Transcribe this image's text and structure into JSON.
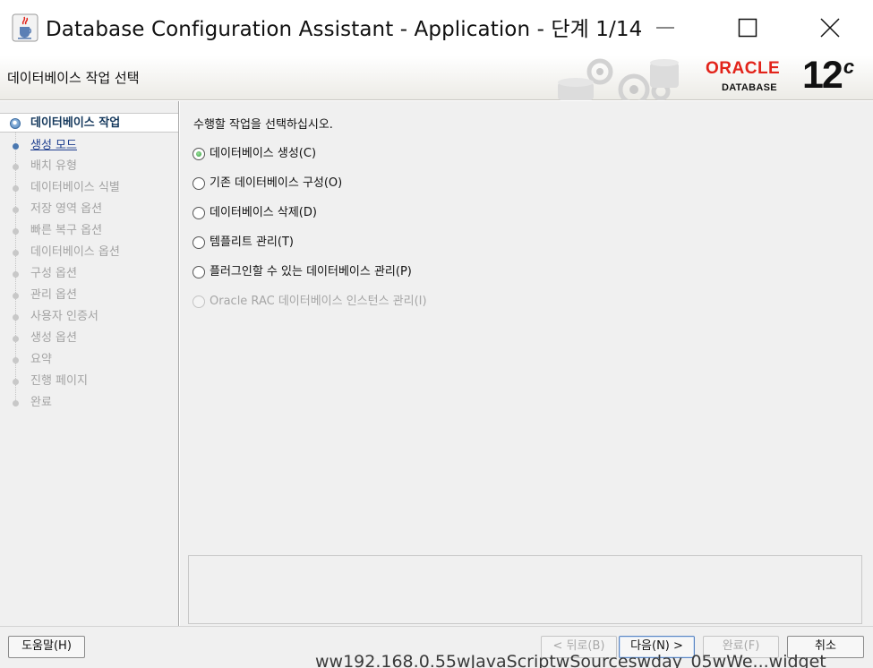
{
  "window": {
    "title": "Database Configuration Assistant - Application - 단계 1/14",
    "icon": "java-cup-icon"
  },
  "header": {
    "title": "데이터베이스 작업 선택",
    "oracle_word": "ORACLE",
    "oracle_product": "DATABASE",
    "oracle_version": "12",
    "oracle_version_suffix": "c",
    "brand_color": "#e2231a"
  },
  "nav": {
    "items": [
      {
        "label": "데이터베이스 작업",
        "state": "current"
      },
      {
        "label": "생성 모드",
        "state": "link"
      },
      {
        "label": "배치 유형",
        "state": "disabled"
      },
      {
        "label": "데이터베이스 식별",
        "state": "disabled"
      },
      {
        "label": "저장 영역 옵션",
        "state": "disabled"
      },
      {
        "label": "빠른 복구 옵션",
        "state": "disabled"
      },
      {
        "label": "데이터베이스 옵션",
        "state": "disabled"
      },
      {
        "label": "구성 옵션",
        "state": "disabled"
      },
      {
        "label": "관리 옵션",
        "state": "disabled"
      },
      {
        "label": "사용자 인증서",
        "state": "disabled"
      },
      {
        "label": "생성 옵션",
        "state": "disabled"
      },
      {
        "label": "요약",
        "state": "disabled"
      },
      {
        "label": "진행 페이지",
        "state": "disabled"
      },
      {
        "label": "완료",
        "state": "disabled"
      }
    ]
  },
  "main": {
    "instruction": "수행할 작업을 선택하십시오.",
    "options": [
      {
        "label": "데이터베이스 생성(C)",
        "checked": true,
        "enabled": true
      },
      {
        "label": "기존 데이터베이스 구성(O)",
        "checked": false,
        "enabled": true
      },
      {
        "label": "데이터베이스 삭제(D)",
        "checked": false,
        "enabled": true
      },
      {
        "label": "템플리트 관리(T)",
        "checked": false,
        "enabled": true
      },
      {
        "label": "플러그인할 수 있는 데이터베이스 관리(P)",
        "checked": false,
        "enabled": true
      },
      {
        "label": "Oracle RAC 데이터베이스 인스턴스 관리(I)",
        "checked": false,
        "enabled": false
      }
    ]
  },
  "footer": {
    "help": "도움말(H)",
    "back": "< 뒤로(B)",
    "next": "다음(N) >",
    "finish": "완료(F)",
    "cancel": "취소"
  },
  "overlay_text": "ww192.168.0.55wJavaScriptwSourceswday_05wWe...widget"
}
